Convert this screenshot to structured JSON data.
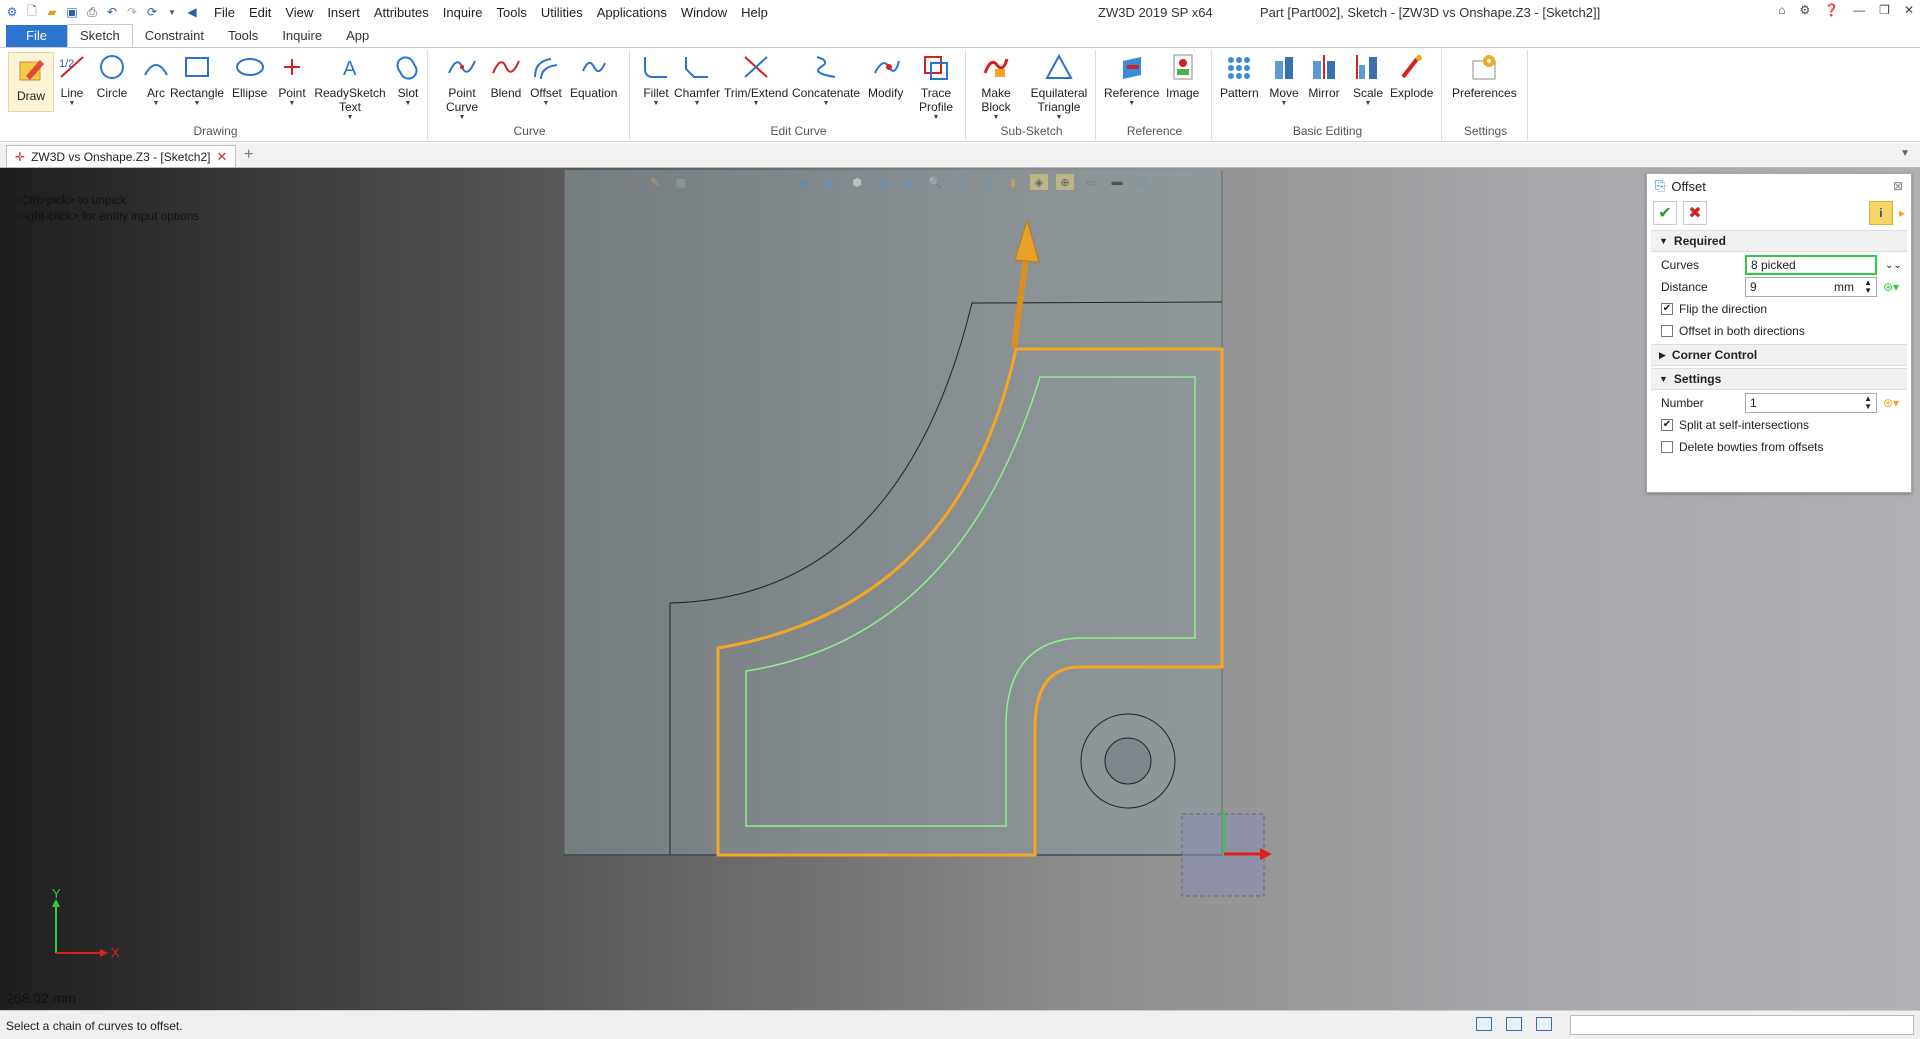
{
  "app": {
    "title": "ZW3D 2019 SP x64",
    "window_title": "Part [Part002], Sketch - [ZW3D vs Onshape.Z3 - [Sketch2]]",
    "menus": [
      "File",
      "Edit",
      "View",
      "Insert",
      "Attributes",
      "Inquire",
      "Tools",
      "Utilities",
      "Applications",
      "Window",
      "Help"
    ]
  },
  "ribbon_tabs": [
    "File",
    "Sketch",
    "Constraint",
    "Tools",
    "Inquire",
    "App"
  ],
  "ribbon": {
    "drawing": {
      "label": "Drawing",
      "tools": [
        "Draw",
        "Line",
        "Circle",
        "Arc",
        "Rectangle",
        "Ellipse",
        "Point",
        "ReadySketch Text",
        "Slot"
      ]
    },
    "curve": {
      "label": "Curve",
      "tools": [
        "Point Curve",
        "Blend",
        "Offset",
        "Equation"
      ]
    },
    "edit_curve": {
      "label": "Edit Curve",
      "tools": [
        "Fillet",
        "Chamfer",
        "Trim/Extend",
        "Concatenate",
        "Modify",
        "Trace Profile"
      ]
    },
    "sub_sketch": {
      "label": "Sub-Sketch",
      "tools": [
        "Make Block",
        "Equilateral Triangle"
      ]
    },
    "reference": {
      "label": "Reference",
      "tools": [
        "Reference",
        "Image"
      ]
    },
    "basic_editing": {
      "label": "Basic Editing",
      "tools": [
        "Pattern",
        "Move",
        "Mirror",
        "Scale",
        "Explode"
      ]
    },
    "settings": {
      "label": "Settings",
      "tools": [
        "Preferences"
      ]
    }
  },
  "document_tab": "ZW3D vs Onshape.Z3 - [Sketch2]",
  "viewport": {
    "hint_line1": "<Ctrl>pick> to unpick",
    "hint_line2": "<right-click> for entity input options",
    "scale": "268.02 mm",
    "axis_x": "X",
    "axis_y": "Y"
  },
  "panel": {
    "title": "Offset",
    "required": "Required",
    "curves_label": "Curves",
    "curves_value": "8 picked",
    "distance_label": "Distance",
    "distance_value": "9",
    "distance_unit": "mm",
    "flip_label": "Flip the direction",
    "flip_checked": true,
    "both_label": "Offset in both directions",
    "both_checked": false,
    "corner_control": "Corner Control",
    "settings": "Settings",
    "number_label": "Number",
    "number_value": "1",
    "split_label": "Split at self-intersections",
    "split_checked": true,
    "bowties_label": "Delete bowties from offsets",
    "bowties_checked": false
  },
  "status": {
    "message": "Select a chain of curves to offset."
  },
  "colors": {
    "accent": "#2a74d0",
    "selection": "#f5a623",
    "offset_preview": "#8ef08e"
  }
}
